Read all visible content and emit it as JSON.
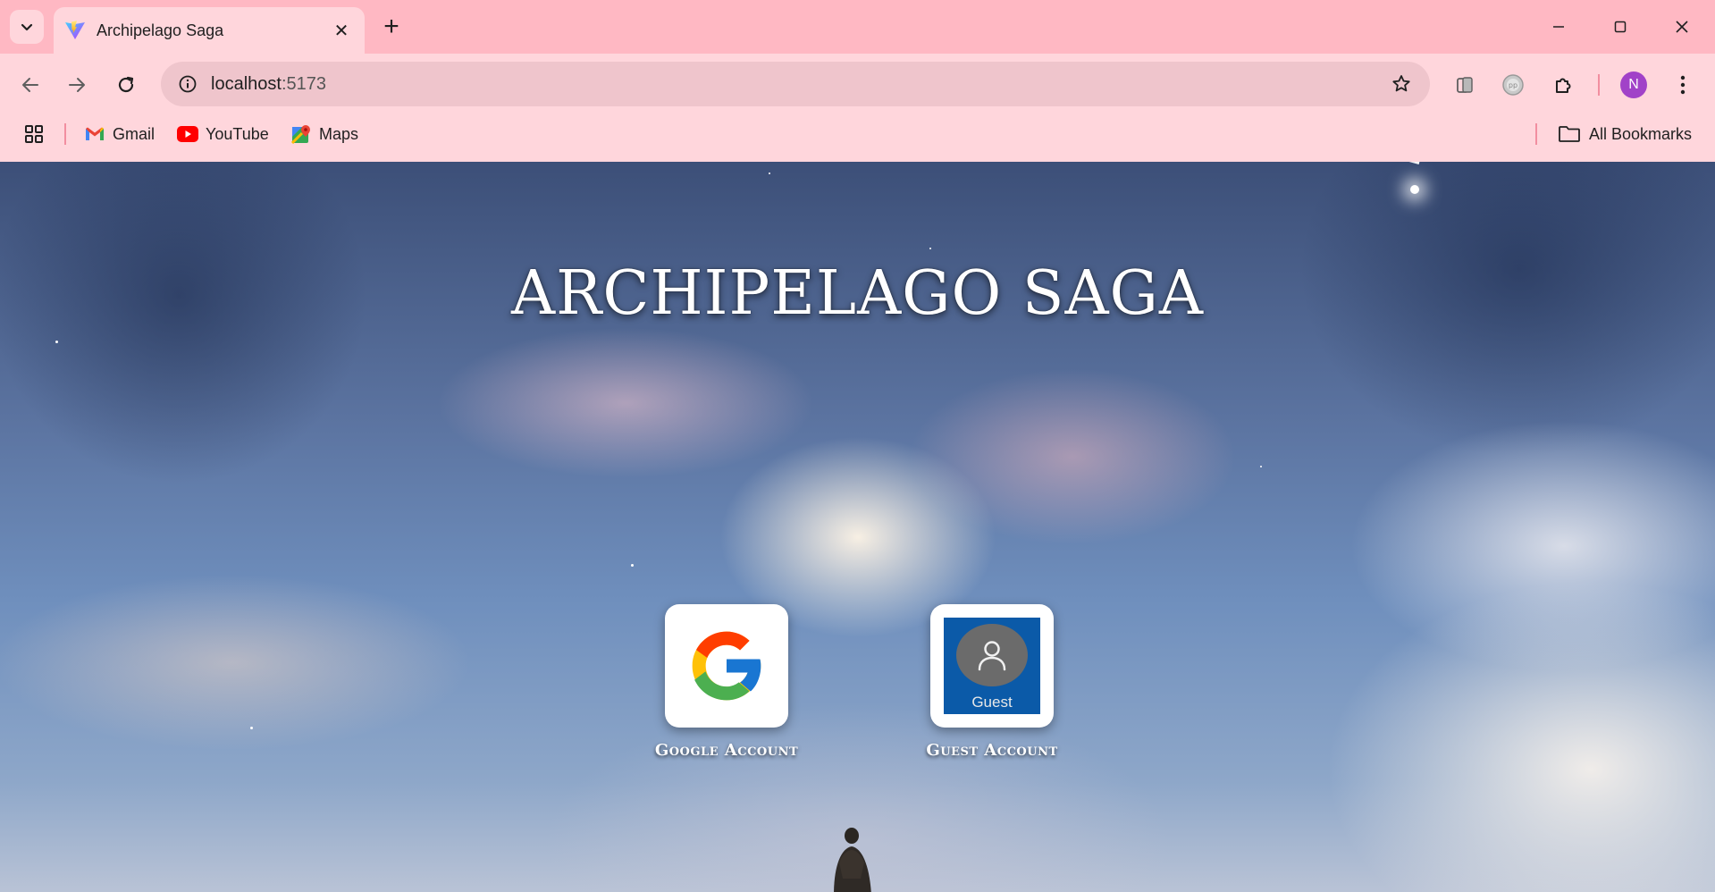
{
  "browser": {
    "tab_title": "Archipelago Saga",
    "tab_close_label": "✕",
    "new_tab_label": "+",
    "url_host": "localhost",
    "url_port": ":5173",
    "profile_initial": "N",
    "profile_color": "#a142c8"
  },
  "bookmarks": {
    "items": [
      {
        "label": "Gmail",
        "icon": "gmail-icon"
      },
      {
        "label": "YouTube",
        "icon": "youtube-icon"
      },
      {
        "label": "Maps",
        "icon": "maps-icon"
      }
    ],
    "all_bookmarks_label": "All Bookmarks"
  },
  "page": {
    "title": "ARCHIPELAGO SAGA",
    "login_options": [
      {
        "label": "Google Account",
        "icon": "google-logo-icon"
      },
      {
        "label": "Guest Account",
        "icon": "guest-user-icon",
        "tile_text": "Guest"
      }
    ]
  },
  "colors": {
    "tabstrip": "#ffb8c3",
    "toolbar": "#ffd6dc",
    "omnibox": "#efc5cc",
    "guest_tile": "#0b5aa8"
  }
}
